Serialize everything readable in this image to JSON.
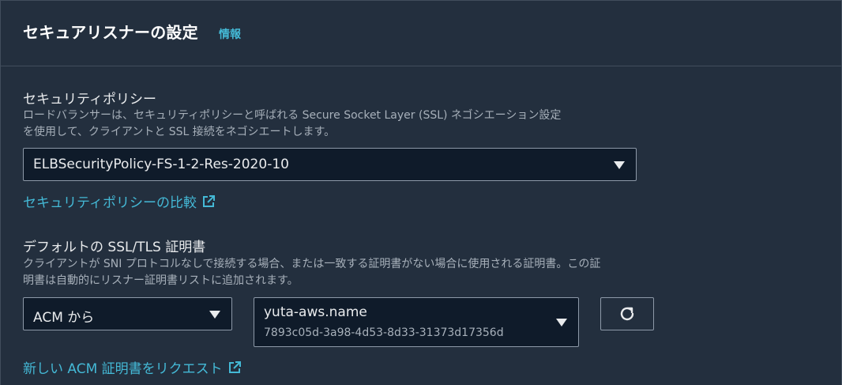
{
  "header": {
    "title": "セキュアリスナーの設定",
    "info_label": "情報"
  },
  "security_policy": {
    "label": "セキュリティポリシー",
    "description_line1": "ロードバランサーは、セキュリティポリシーと呼ばれる Secure Socket Layer (SSL) ネゴシエーション設定",
    "description_line2": "を使用して、クライアントと SSL 接続をネゴシエートします。",
    "selected_value": "ELBSecurityPolicy-FS-1-2-Res-2020-10",
    "compare_link": "セキュリティポリシーの比較"
  },
  "default_cert": {
    "label": "デフォルトの SSL/TLS 証明書",
    "description_line1": "クライアントが SNI プロトコルなしで接続する場合、または一致する証明書がない場合に使用される証明書。この証",
    "description_line2": "明書は自動的にリスナー証明書リストに追加されます。",
    "source_value": "ACM から",
    "cert_name": "yuta-aws.name",
    "cert_id": "7893c05d-3a98-4d53-8d33-31373d17356d",
    "request_link": "新しい ACM 証明書をリクエスト"
  },
  "colors": {
    "background": "#232f3e",
    "link": "#44b9d6",
    "input_bg": "#0f1b2a",
    "border": "#8d99a8"
  },
  "icons": {
    "external_link": "external-link-icon",
    "refresh": "refresh-icon",
    "caret": "caret-down-icon"
  }
}
